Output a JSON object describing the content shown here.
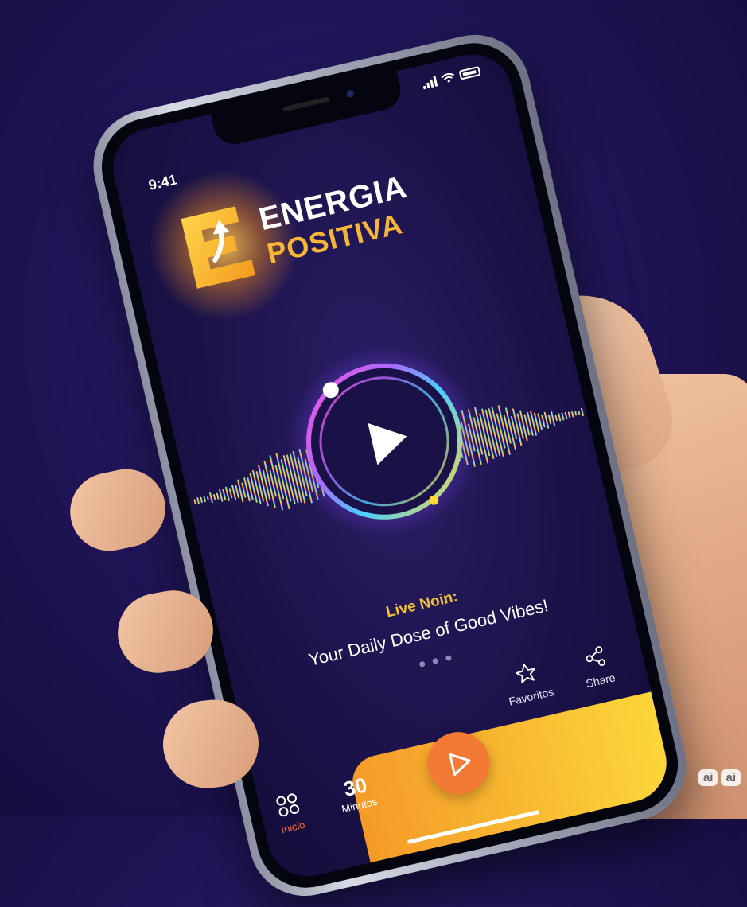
{
  "status_bar": {
    "time": "9:41"
  },
  "logo": {
    "line1": "ENERGIA",
    "line2": "POSITIVA"
  },
  "now_playing": {
    "live_label": "Live Noin:",
    "tagline": "Your Daily Dose of Good Vibes!"
  },
  "actions": [
    {
      "label": "Favoritos",
      "icon": "star-icon"
    },
    {
      "label": "Share",
      "icon": "share-icon"
    }
  ],
  "tabbar": {
    "home_label": "Inicio",
    "minutes_value": "30",
    "minutes_label": "Minutos"
  },
  "watermark": [
    "ai",
    "ai"
  ],
  "colors": {
    "accent_yellow": "#f4c431",
    "accent_orange": "#f27a34",
    "background": "#1b1249"
  }
}
